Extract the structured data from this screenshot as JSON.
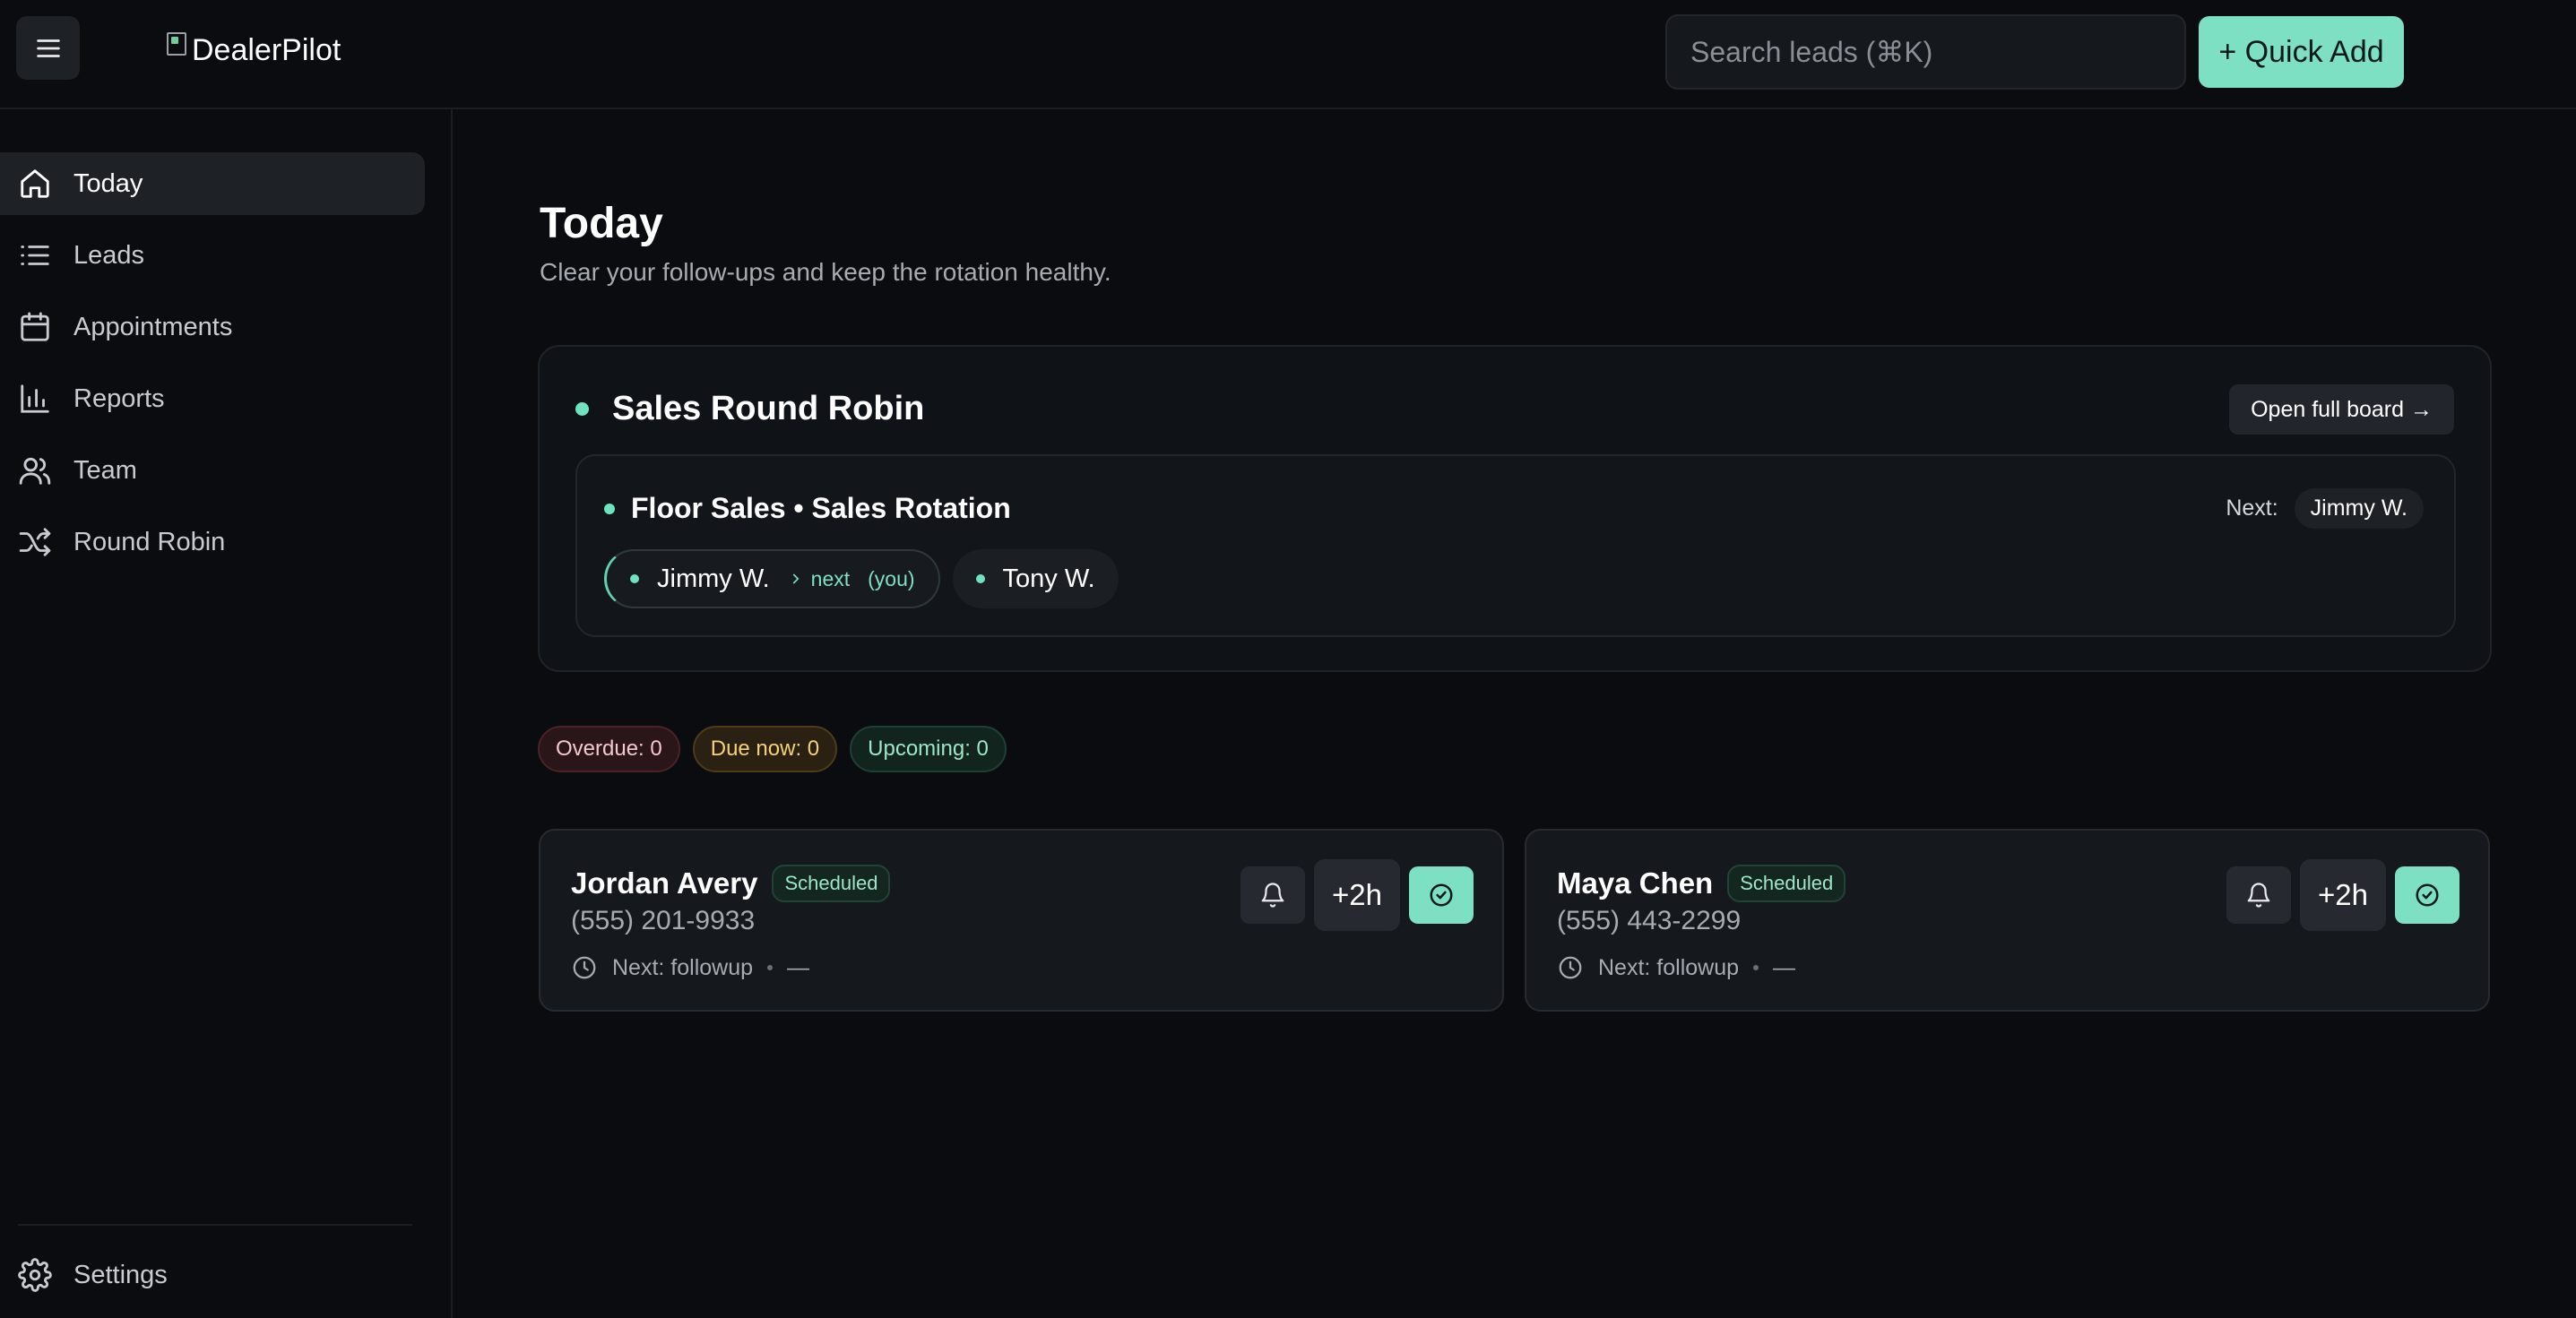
{
  "header": {
    "logo_alt": "DealerPilot",
    "search_placeholder": "Search leads (⌘K)",
    "quick_add_label": "+ Quick Add"
  },
  "sidebar": {
    "items": [
      {
        "label": "Today",
        "icon": "home-icon",
        "active": true
      },
      {
        "label": "Leads",
        "icon": "list-icon",
        "active": false
      },
      {
        "label": "Appointments",
        "icon": "calendar-icon",
        "active": false
      },
      {
        "label": "Reports",
        "icon": "bar-chart-icon",
        "active": false
      },
      {
        "label": "Team",
        "icon": "users-icon",
        "active": false
      },
      {
        "label": "Round Robin",
        "icon": "shuffle-icon",
        "active": false
      }
    ],
    "settings_label": "Settings"
  },
  "main": {
    "title": "Today",
    "subtitle": "Clear your follow-ups and keep the rotation healthy.",
    "round_robin": {
      "title": "Sales Round Robin",
      "open_board_label": "Open full board →",
      "rotation": {
        "title": "Floor Sales • Sales Rotation",
        "next_label": "Next:",
        "next_name": "Jimmy W.",
        "members": [
          {
            "name": "Jimmy W.",
            "next_tag": "next",
            "you_tag": "(you)"
          },
          {
            "name": "Tony W."
          }
        ]
      }
    },
    "badges": {
      "overdue": "Overdue: 0",
      "due_now": "Due now: 0",
      "upcoming": "Upcoming: 0"
    },
    "leads": [
      {
        "name": "Jordan Avery",
        "status": "Scheduled",
        "phone": "(555) 201-9933",
        "next": "Next: followup",
        "next_time": "—",
        "delay_label": "+2h"
      },
      {
        "name": "Maya Chen",
        "status": "Scheduled",
        "phone": "(555) 443-2299",
        "next": "Next: followup",
        "next_time": "—",
        "delay_label": "+2h"
      }
    ]
  },
  "colors": {
    "accent": "#7ee0c3",
    "background": "#0a0c10",
    "card": "#15181c"
  }
}
